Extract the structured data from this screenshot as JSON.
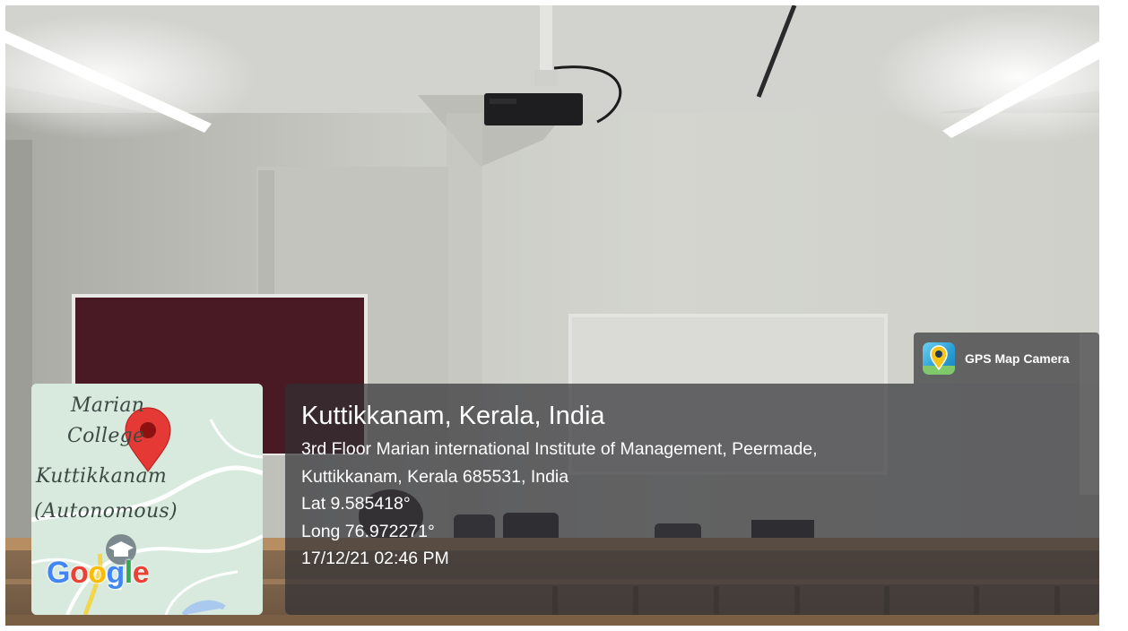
{
  "badge": {
    "app_name": "GPS Map Camera",
    "icon": "gps-map-camera-app-icon"
  },
  "location": {
    "title": "Kuttikkanam, Kerala, India",
    "address_line1": "3rd Floor Marian international Institute of Management, Peermade,",
    "address_line2": "Kuttikkanam, Kerala 685531, India",
    "latitude": "Lat 9.585418°",
    "longitude": "Long 76.972271°",
    "datetime": "17/12/21 02:46 PM"
  },
  "map": {
    "labels": [
      "Marian",
      "College",
      "Kuttikkanam",
      "(Autonomous)"
    ],
    "logo_text": "Google",
    "pin_icon": "map-pin-icon",
    "poi_icon": "graduation-cap-icon",
    "colors": {
      "land": "#d7eadd",
      "road": "#ffffff",
      "pin": "#e53935",
      "water": "#aac9ee"
    }
  },
  "colors": {
    "panel": "#303034",
    "text": "#ffffff",
    "google_blue": "#4285F4",
    "google_red": "#EA4335",
    "google_yellow": "#FBBC05",
    "google_green": "#34A853"
  }
}
